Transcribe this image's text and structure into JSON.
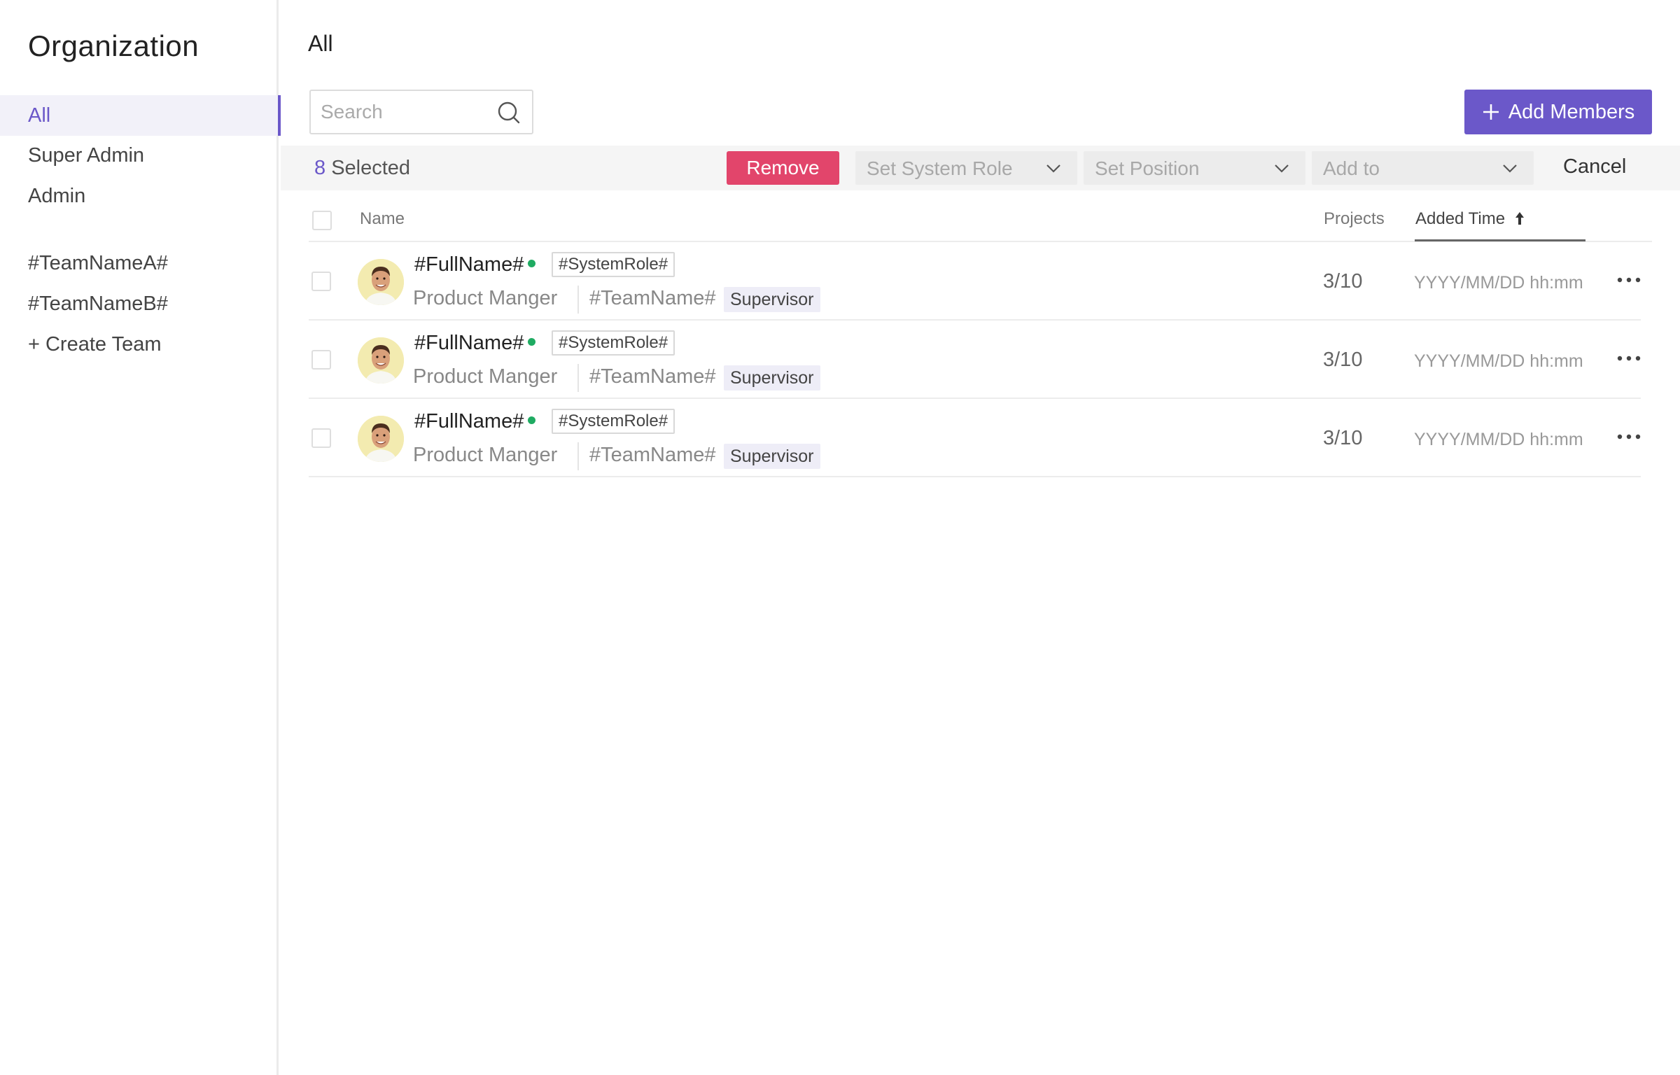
{
  "sidebar": {
    "title": "Organization",
    "items": [
      {
        "label": "All",
        "active": true
      },
      {
        "label": "Super Admin"
      },
      {
        "label": "Admin"
      },
      {
        "label": "#TeamNameA#"
      },
      {
        "label": "#TeamNameB#"
      },
      {
        "label": "+ Create Team"
      }
    ]
  },
  "main": {
    "title": "All",
    "search": {
      "placeholder": "Search",
      "value": ""
    },
    "add_button": {
      "label": "Add Members",
      "icon": "plus-icon"
    }
  },
  "action_bar": {
    "selected_count": "8",
    "selected_label": "Selected",
    "remove_label": "Remove",
    "set_system_role_label": "Set System Role",
    "set_position_label": "Set Position",
    "add_to_label": "Add to",
    "cancel_label": "Cancel"
  },
  "table": {
    "columns": {
      "name": "Name",
      "projects": "Projects",
      "added_time": "Added Time",
      "sort": "ascending"
    },
    "rows": [
      {
        "full_name": "#FullName#",
        "online": true,
        "system_role": "#SystemRole#",
        "position": "Product Manger",
        "team": "#TeamName#",
        "team_role": "Supervisor",
        "projects": "3/10",
        "added_time": "YYYY/MM/DD hh:mm"
      },
      {
        "full_name": "#FullName#",
        "online": true,
        "system_role": "#SystemRole#",
        "position": "Product Manger",
        "team": "#TeamName#",
        "team_role": "Supervisor",
        "projects": "3/10",
        "added_time": "YYYY/MM/DD hh:mm"
      },
      {
        "full_name": "#FullName#",
        "online": true,
        "system_role": "#SystemRole#",
        "position": "Product Manger",
        "team": "#TeamName#",
        "team_role": "Supervisor",
        "projects": "3/10",
        "added_time": "YYYY/MM/DD hh:mm"
      }
    ]
  },
  "colors": {
    "accent": "#6b58c9",
    "danger": "#e2456b",
    "online": "#1fab62"
  }
}
